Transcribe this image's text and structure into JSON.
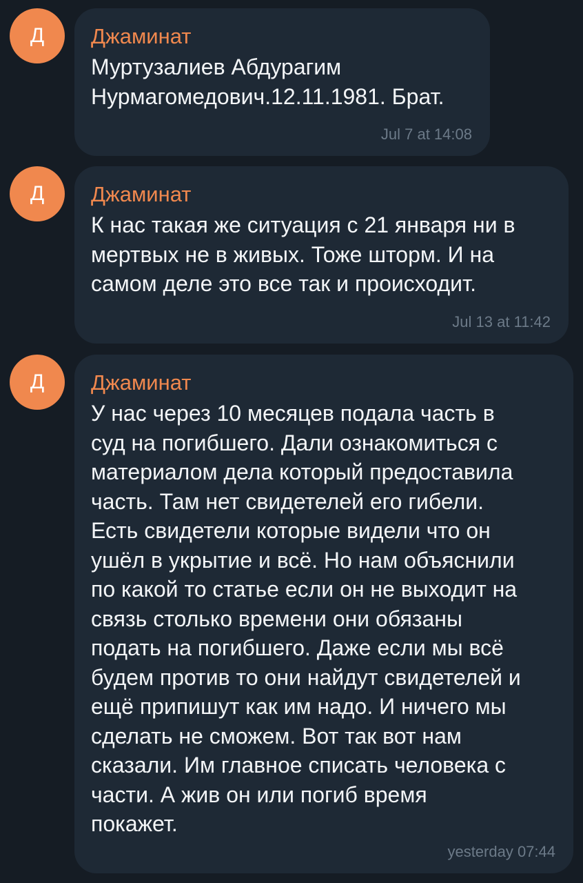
{
  "messages": [
    {
      "avatar_letter": "Д",
      "sender": "Джаминат",
      "text": "Муртузалиев Абдурагим\nНурмагомедович.12.11.1981. Брат.",
      "time": "Jul 7 at 14:08"
    },
    {
      "avatar_letter": "Д",
      "sender": "Джаминат",
      "text": "К нас такая же ситуация с 21 января ни в\nмертвых не в живых. Тоже шторм. И на\nсамом деле это все так и происходит.",
      "time": "Jul 13 at 11:42"
    },
    {
      "avatar_letter": "Д",
      "sender": "Джаминат",
      "text": "У нас через 10 месяцев подала часть в\nсуд на погибшего. Дали ознакомиться с\nматериалом дела который предоставила\nчасть. Там нет свидетелей его гибели.\nЕсть свидетели  которые видели что он\nушёл в укрытие и всё. Но нам объяснили\nпо какой то статье если он не выходит на\nсвязь столько времени они обязаны\nподать на погибшего. Даже если мы всё\nбудем против то они найдут свидетелей и\nещё припишут как им надо. И ничего мы\nсделать не сможем. Вот так вот нам\nсказали. Им главное списать человека с\nчасти. А жив он или погиб время\nпокажет.",
      "time": "yesterday 07:44"
    }
  ],
  "colors": {
    "background": "#151c24",
    "bubble": "#1e2935",
    "accent": "#f0884e",
    "timestamp": "#6c7a88",
    "text": "#f3f5f7"
  }
}
